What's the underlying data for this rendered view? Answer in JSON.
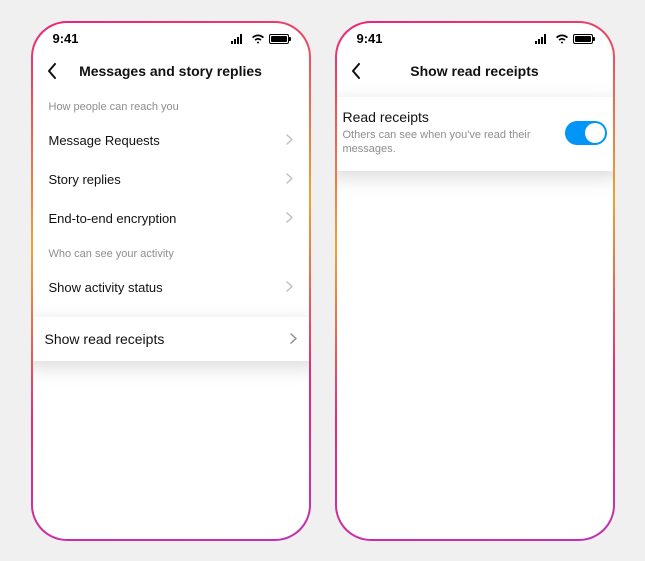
{
  "status": {
    "time": "9:41"
  },
  "left": {
    "title": "Messages and story replies",
    "section1": "How people can reach you",
    "items1": [
      {
        "label": "Message Requests"
      },
      {
        "label": "Story replies"
      },
      {
        "label": "End-to-end encryption"
      }
    ],
    "section2": "Who can see your activity",
    "items2": [
      {
        "label": "Show activity status"
      }
    ],
    "highlight": {
      "label": "Show read receipts"
    }
  },
  "right": {
    "title": "Show read receipts",
    "card": {
      "title": "Read receipts",
      "subtitle": "Others can see when you've read their messages.",
      "on": true
    }
  }
}
